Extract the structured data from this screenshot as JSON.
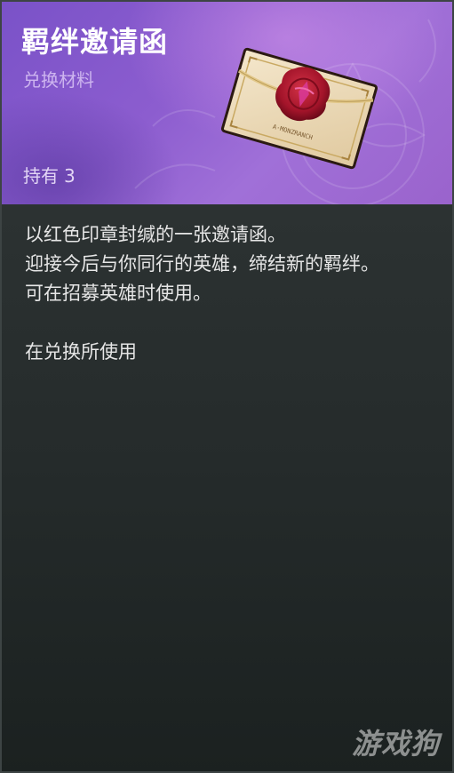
{
  "item": {
    "name": "羁绊邀请函",
    "category": "兑换材料",
    "owned_label": "持有",
    "owned_count": "3",
    "icon": "wax-sealed-invitation-letter",
    "seal_text": "A·MONZRANCH"
  },
  "description": {
    "lines": [
      "以红色印章封缄的一张邀请函。",
      "迎接今后与你同行的英雄，缔结新的羁绊。",
      "可在招募英雄时使用。"
    ],
    "usage": "在兑换所使用"
  },
  "watermark": "游戏狗",
  "colors": {
    "header_purple": "#8c5dcf",
    "panel_dark": "#2c3232",
    "seal_red": "#b3182b",
    "text_light": "#e6e6e6",
    "subtitle_lilac": "#cdb4ef"
  }
}
